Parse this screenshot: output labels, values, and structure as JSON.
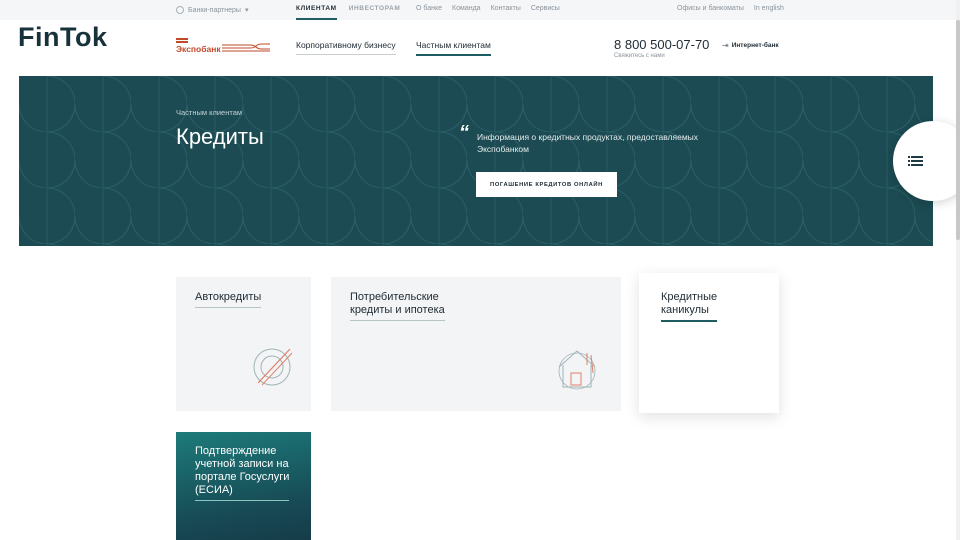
{
  "watermark": "FinTok",
  "topbar": {
    "partners_label": "Банки-партнеры",
    "nav_main": [
      {
        "label": "КЛИЕНТАМ",
        "active": true
      },
      {
        "label": "ИНВЕСТОРАМ",
        "active": false
      }
    ],
    "nav_links": [
      "О банке",
      "Команда",
      "Контакты",
      "Сервисы"
    ],
    "nav_right": [
      "Офисы и банкоматы",
      "In english"
    ]
  },
  "header": {
    "logo_text": "Экспобанк",
    "nav": {
      "business": "Корпоративному бизнесу",
      "private": "Частным клиентам"
    },
    "phone": "8 800 500-07-70",
    "phone_sub": "Свяжитесь с нами",
    "internet_bank": "Интернет-банк"
  },
  "hero": {
    "breadcrumb": "Частным клиентам",
    "title": "Кредиты",
    "quote_mark": "“",
    "description": "Информация о кредитных продуктах, предоставляемых Экспобанком",
    "button_label": "ПОГАШЕНИЕ КРЕДИТОВ ОНЛАЙН"
  },
  "cards": {
    "auto": "Автокредиты",
    "consumer_line1": "Потребительские",
    "consumer_line2": "кредиты и ипотека",
    "holidays_line1": "Кредитные",
    "holidays_line2": "каникулы",
    "esia_line1": "Подтверждение",
    "esia_line2": "учетной записи на",
    "esia_line3": "портале Госуслуги",
    "esia_line4": "(ЕСИА)"
  },
  "colors": {
    "brand": "#c24a2a",
    "hero_bg": "#1c4b53",
    "accent": "#1e5d62"
  },
  "icons": {
    "globe": "globe-icon",
    "menu": "menu-list-icon",
    "login": "login-arrow-icon",
    "auto": "car-loan-icon",
    "home": "house-icon"
  }
}
